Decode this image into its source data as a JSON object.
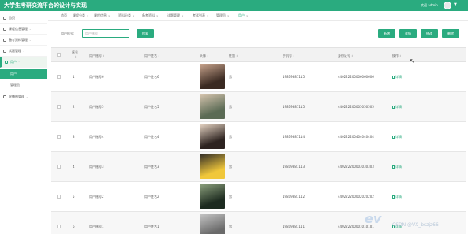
{
  "header": {
    "app_title": "大学生考研交流平台的设计与实现",
    "user_name": "欢迎 admin",
    "user_caret": "▼"
  },
  "sidebar": {
    "items": [
      {
        "label": "首页",
        "arrow": "",
        "icon": "home-icon"
      },
      {
        "label": "课程信息管理",
        "arrow": "⌄",
        "icon": "book-icon"
      },
      {
        "label": "备考资料管理",
        "arrow": "⌄",
        "icon": "folder-icon"
      },
      {
        "label": "试题管理",
        "arrow": "⌄",
        "icon": "document-icon"
      },
      {
        "label": "用户",
        "arrow": "⌃",
        "icon": "user-icon",
        "active": true
      },
      {
        "label": "轮播图管理",
        "arrow": "⌄",
        "icon": "image-icon"
      }
    ],
    "sub_items": [
      {
        "label": "用户",
        "active": true
      },
      {
        "label": "管理员",
        "active": false
      }
    ]
  },
  "tabs": [
    {
      "label": "首页",
      "close": ""
    },
    {
      "label": "课程分类",
      "close": "×"
    },
    {
      "label": "课程信息",
      "close": "×"
    },
    {
      "label": "资料分类",
      "close": "×"
    },
    {
      "label": "备考资料",
      "close": "×"
    },
    {
      "label": "试题管理",
      "close": "×"
    },
    {
      "label": "考试列表",
      "close": "×"
    },
    {
      "label": "管理员",
      "close": "×"
    },
    {
      "label": "用户",
      "close": "×"
    }
  ],
  "search": {
    "label": "用户账号:",
    "placeholder": "用户账号",
    "search_button": "搜索"
  },
  "toolbar": {
    "add": "新增",
    "detail": "详情",
    "edit": "修改",
    "delete": "删除"
  },
  "table": {
    "headers": [
      "序号",
      "用户账号",
      "用户姓名",
      "头像",
      "性别",
      "手机号",
      "身份证号",
      "操作"
    ],
    "sort_icon": "⇕",
    "rows": [
      {
        "index": "1",
        "account": "用户账号6",
        "name": "用户姓名6",
        "gender": "男",
        "phone": "19819881115",
        "id_card": "440222200006060606",
        "action": "详情"
      },
      {
        "index": "2",
        "account": "用户账号5",
        "name": "用户姓名5",
        "gender": "男",
        "phone": "19819881115",
        "id_card": "440222200005050505",
        "action": "详情"
      },
      {
        "index": "3",
        "account": "用户账号4",
        "name": "用户姓名4",
        "gender": "男",
        "phone": "19819881114",
        "id_card": "440222200404040404",
        "action": "详情"
      },
      {
        "index": "4",
        "account": "用户账号3",
        "name": "用户姓名3",
        "gender": "男",
        "phone": "19819881113",
        "id_card": "440222200003030303",
        "action": "详情"
      },
      {
        "index": "5",
        "account": "用户账号2",
        "name": "用户姓名2",
        "gender": "男",
        "phone": "19819881112",
        "id_card": "440222200002020202",
        "action": "详情"
      },
      {
        "index": "6",
        "account": "用户账号1",
        "name": "用户姓名1",
        "gender": "男",
        "phone": "19819881111",
        "id_card": "440222200001010101",
        "action": "详情"
      }
    ]
  },
  "watermark": {
    "logo_text": "ev",
    "credit": "CSDN @VX_bszjz66"
  },
  "colors": {
    "brand": "#2aab7f",
    "row_alt": "#f7f7f7",
    "header_bg": "#f2f2f2"
  }
}
